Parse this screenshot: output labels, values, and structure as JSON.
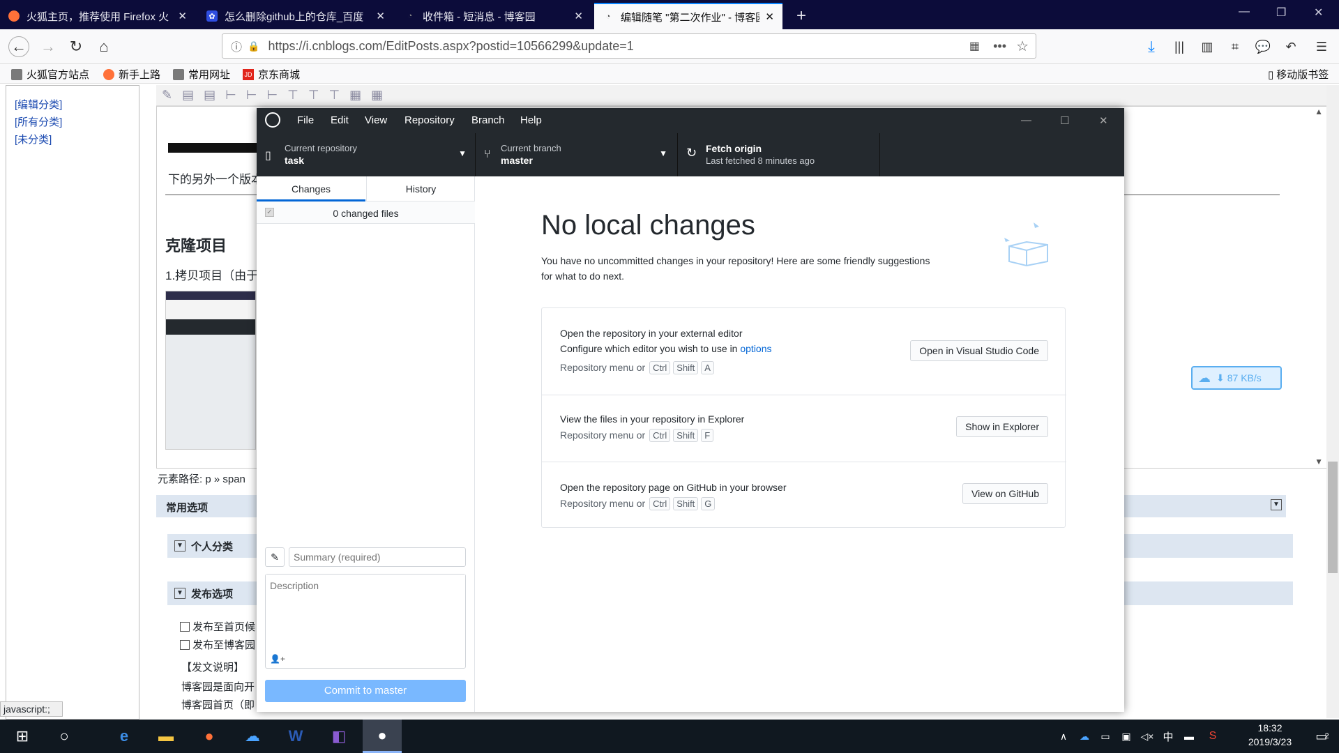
{
  "browser": {
    "tabs": [
      {
        "title": "火狐主页，推荐使用 Firefox 火"
      },
      {
        "title": "怎么删除github上的仓库_百度"
      },
      {
        "title": "收件箱 - 短消息 - 博客园"
      },
      {
        "title": "编辑随笔 \"第二次作业\" - 博客园"
      }
    ],
    "url": "https://i.cnblogs.com/EditPosts.aspx?postid=10566299&update=1",
    "bookmarks": [
      "火狐官方站点",
      "新手上路",
      "常用网址",
      "京东商城"
    ],
    "mobile_bookmarks": "移动版书签",
    "status": "javascript:;"
  },
  "page": {
    "categories": [
      "[编辑分类]",
      "[所有分类]",
      "[未分类]"
    ],
    "editor_text1": "下的另外一个版本",
    "heading": "克隆项目",
    "step1": "1.拷贝项目（由于",
    "element_path": "元素路径: p » span",
    "section_common": "常用选项",
    "personal_category": "个人分类",
    "publish_options": "发布选项",
    "publish_home": "发布至首页候",
    "publish_blog": "发布至博客园",
    "publish_note": "【发文说明】",
    "note_line1": "博客园是面向开",
    "note_line2": "博客园首页（即",
    "download_speed": "87 KB/s"
  },
  "ghd": {
    "menus": [
      "File",
      "Edit",
      "View",
      "Repository",
      "Branch",
      "Help"
    ],
    "current_repo_label": "Current repository",
    "current_repo": "task",
    "current_branch_label": "Current branch",
    "current_branch": "master",
    "fetch_label": "Fetch origin",
    "fetch_sub": "Last fetched 8 minutes ago",
    "tab_changes": "Changes",
    "tab_history": "History",
    "changed_files": "0 changed files",
    "summary_placeholder": "Summary (required)",
    "description_placeholder": "Description",
    "commit_button": "Commit to master",
    "no_changes_title": "No local changes",
    "no_changes_desc": "You have no uncommitted changes in your repository! Here are some friendly suggestions for what to do next.",
    "editor_title": "Open the repository in your external editor",
    "editor_desc": "Configure which editor you wish to use in ",
    "editor_desc_link": "options",
    "menu_prefix": "Repository menu or",
    "open_vscode_button": "Open in Visual Studio Code",
    "explorer_title": "View the files in your repository in Explorer",
    "show_explorer_button": "Show in Explorer",
    "github_title": "Open the repository page on GitHub in your browser",
    "view_github_button": "View on GitHub",
    "key_ctrl": "Ctrl",
    "key_shift": "Shift",
    "key_a": "A",
    "key_f": "F",
    "key_g": "G"
  },
  "taskbar": {
    "time": "18:32",
    "date": "2019/3/23",
    "ime": "中",
    "notification_count": "2"
  },
  "colors": {
    "accent": "#0366d6",
    "commit_button": "#79b8ff",
    "ghd_dark": "#24292e"
  }
}
